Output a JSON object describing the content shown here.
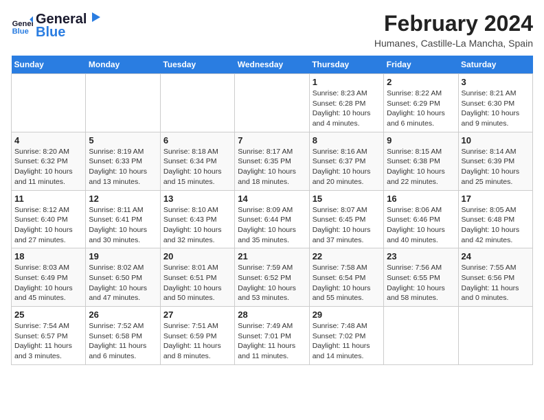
{
  "logo": {
    "line1": "General",
    "line2": "Blue"
  },
  "title": "February 2024",
  "subtitle": "Humanes, Castille-La Mancha, Spain",
  "header_days": [
    "Sunday",
    "Monday",
    "Tuesday",
    "Wednesday",
    "Thursday",
    "Friday",
    "Saturday"
  ],
  "weeks": [
    [
      {
        "day": "",
        "info": ""
      },
      {
        "day": "",
        "info": ""
      },
      {
        "day": "",
        "info": ""
      },
      {
        "day": "",
        "info": ""
      },
      {
        "day": "1",
        "info": "Sunrise: 8:23 AM\nSunset: 6:28 PM\nDaylight: 10 hours\nand 4 minutes."
      },
      {
        "day": "2",
        "info": "Sunrise: 8:22 AM\nSunset: 6:29 PM\nDaylight: 10 hours\nand 6 minutes."
      },
      {
        "day": "3",
        "info": "Sunrise: 8:21 AM\nSunset: 6:30 PM\nDaylight: 10 hours\nand 9 minutes."
      }
    ],
    [
      {
        "day": "4",
        "info": "Sunrise: 8:20 AM\nSunset: 6:32 PM\nDaylight: 10 hours\nand 11 minutes."
      },
      {
        "day": "5",
        "info": "Sunrise: 8:19 AM\nSunset: 6:33 PM\nDaylight: 10 hours\nand 13 minutes."
      },
      {
        "day": "6",
        "info": "Sunrise: 8:18 AM\nSunset: 6:34 PM\nDaylight: 10 hours\nand 15 minutes."
      },
      {
        "day": "7",
        "info": "Sunrise: 8:17 AM\nSunset: 6:35 PM\nDaylight: 10 hours\nand 18 minutes."
      },
      {
        "day": "8",
        "info": "Sunrise: 8:16 AM\nSunset: 6:37 PM\nDaylight: 10 hours\nand 20 minutes."
      },
      {
        "day": "9",
        "info": "Sunrise: 8:15 AM\nSunset: 6:38 PM\nDaylight: 10 hours\nand 22 minutes."
      },
      {
        "day": "10",
        "info": "Sunrise: 8:14 AM\nSunset: 6:39 PM\nDaylight: 10 hours\nand 25 minutes."
      }
    ],
    [
      {
        "day": "11",
        "info": "Sunrise: 8:12 AM\nSunset: 6:40 PM\nDaylight: 10 hours\nand 27 minutes."
      },
      {
        "day": "12",
        "info": "Sunrise: 8:11 AM\nSunset: 6:41 PM\nDaylight: 10 hours\nand 30 minutes."
      },
      {
        "day": "13",
        "info": "Sunrise: 8:10 AM\nSunset: 6:43 PM\nDaylight: 10 hours\nand 32 minutes."
      },
      {
        "day": "14",
        "info": "Sunrise: 8:09 AM\nSunset: 6:44 PM\nDaylight: 10 hours\nand 35 minutes."
      },
      {
        "day": "15",
        "info": "Sunrise: 8:07 AM\nSunset: 6:45 PM\nDaylight: 10 hours\nand 37 minutes."
      },
      {
        "day": "16",
        "info": "Sunrise: 8:06 AM\nSunset: 6:46 PM\nDaylight: 10 hours\nand 40 minutes."
      },
      {
        "day": "17",
        "info": "Sunrise: 8:05 AM\nSunset: 6:48 PM\nDaylight: 10 hours\nand 42 minutes."
      }
    ],
    [
      {
        "day": "18",
        "info": "Sunrise: 8:03 AM\nSunset: 6:49 PM\nDaylight: 10 hours\nand 45 minutes."
      },
      {
        "day": "19",
        "info": "Sunrise: 8:02 AM\nSunset: 6:50 PM\nDaylight: 10 hours\nand 47 minutes."
      },
      {
        "day": "20",
        "info": "Sunrise: 8:01 AM\nSunset: 6:51 PM\nDaylight: 10 hours\nand 50 minutes."
      },
      {
        "day": "21",
        "info": "Sunrise: 7:59 AM\nSunset: 6:52 PM\nDaylight: 10 hours\nand 53 minutes."
      },
      {
        "day": "22",
        "info": "Sunrise: 7:58 AM\nSunset: 6:54 PM\nDaylight: 10 hours\nand 55 minutes."
      },
      {
        "day": "23",
        "info": "Sunrise: 7:56 AM\nSunset: 6:55 PM\nDaylight: 10 hours\nand 58 minutes."
      },
      {
        "day": "24",
        "info": "Sunrise: 7:55 AM\nSunset: 6:56 PM\nDaylight: 11 hours\nand 0 minutes."
      }
    ],
    [
      {
        "day": "25",
        "info": "Sunrise: 7:54 AM\nSunset: 6:57 PM\nDaylight: 11 hours\nand 3 minutes."
      },
      {
        "day": "26",
        "info": "Sunrise: 7:52 AM\nSunset: 6:58 PM\nDaylight: 11 hours\nand 6 minutes."
      },
      {
        "day": "27",
        "info": "Sunrise: 7:51 AM\nSunset: 6:59 PM\nDaylight: 11 hours\nand 8 minutes."
      },
      {
        "day": "28",
        "info": "Sunrise: 7:49 AM\nSunset: 7:01 PM\nDaylight: 11 hours\nand 11 minutes."
      },
      {
        "day": "29",
        "info": "Sunrise: 7:48 AM\nSunset: 7:02 PM\nDaylight: 11 hours\nand 14 minutes."
      },
      {
        "day": "",
        "info": ""
      },
      {
        "day": "",
        "info": ""
      }
    ]
  ]
}
